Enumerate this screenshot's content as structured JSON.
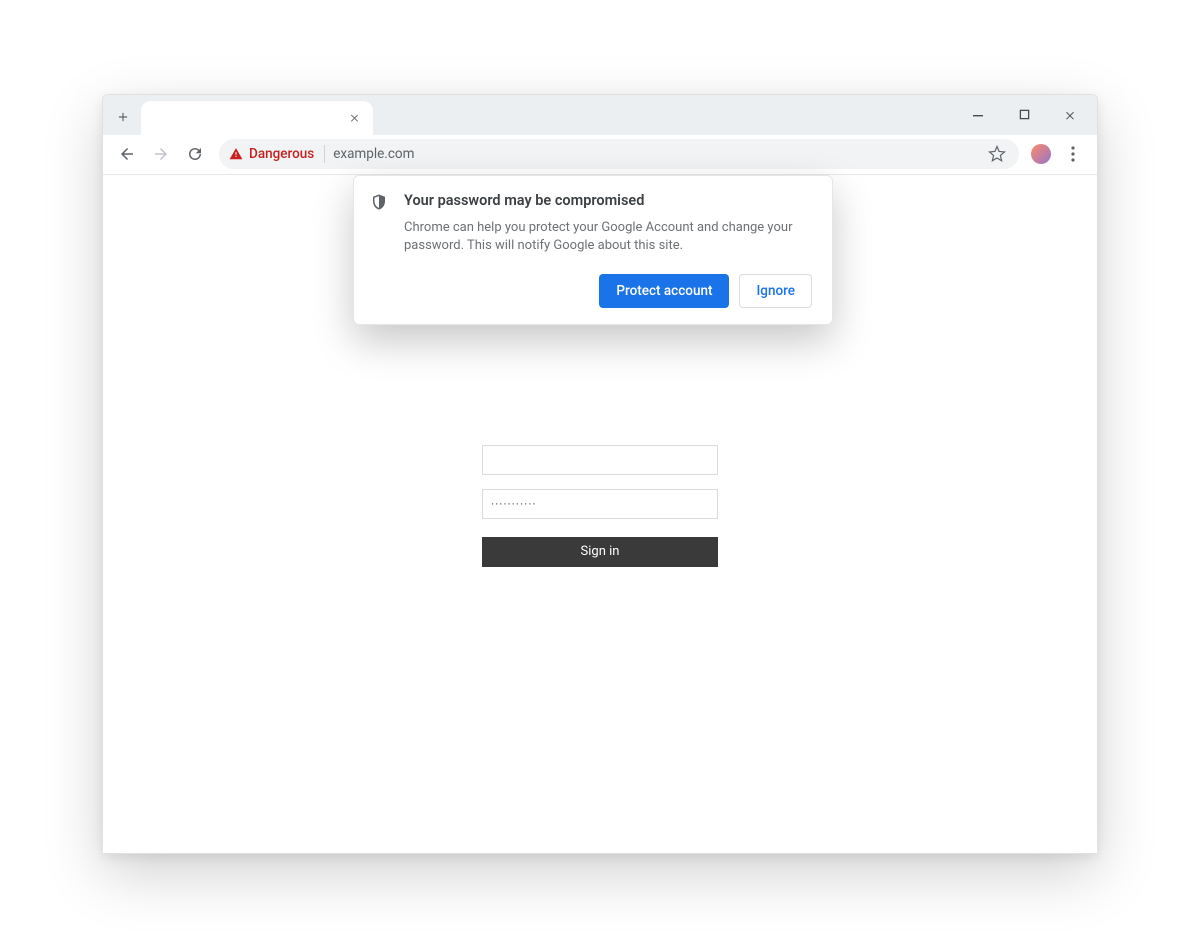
{
  "omnibox": {
    "danger_label": "Dangerous",
    "url": "example.com"
  },
  "popover": {
    "title": "Your password may be compromised",
    "text": "Chrome can help you protect your Google Account and change your password. This will notify Google about this site.",
    "protect_label": "Protect account",
    "ignore_label": "Ignore"
  },
  "form": {
    "username_value": "",
    "password_display": "···········",
    "signin_label": "Sign in"
  }
}
